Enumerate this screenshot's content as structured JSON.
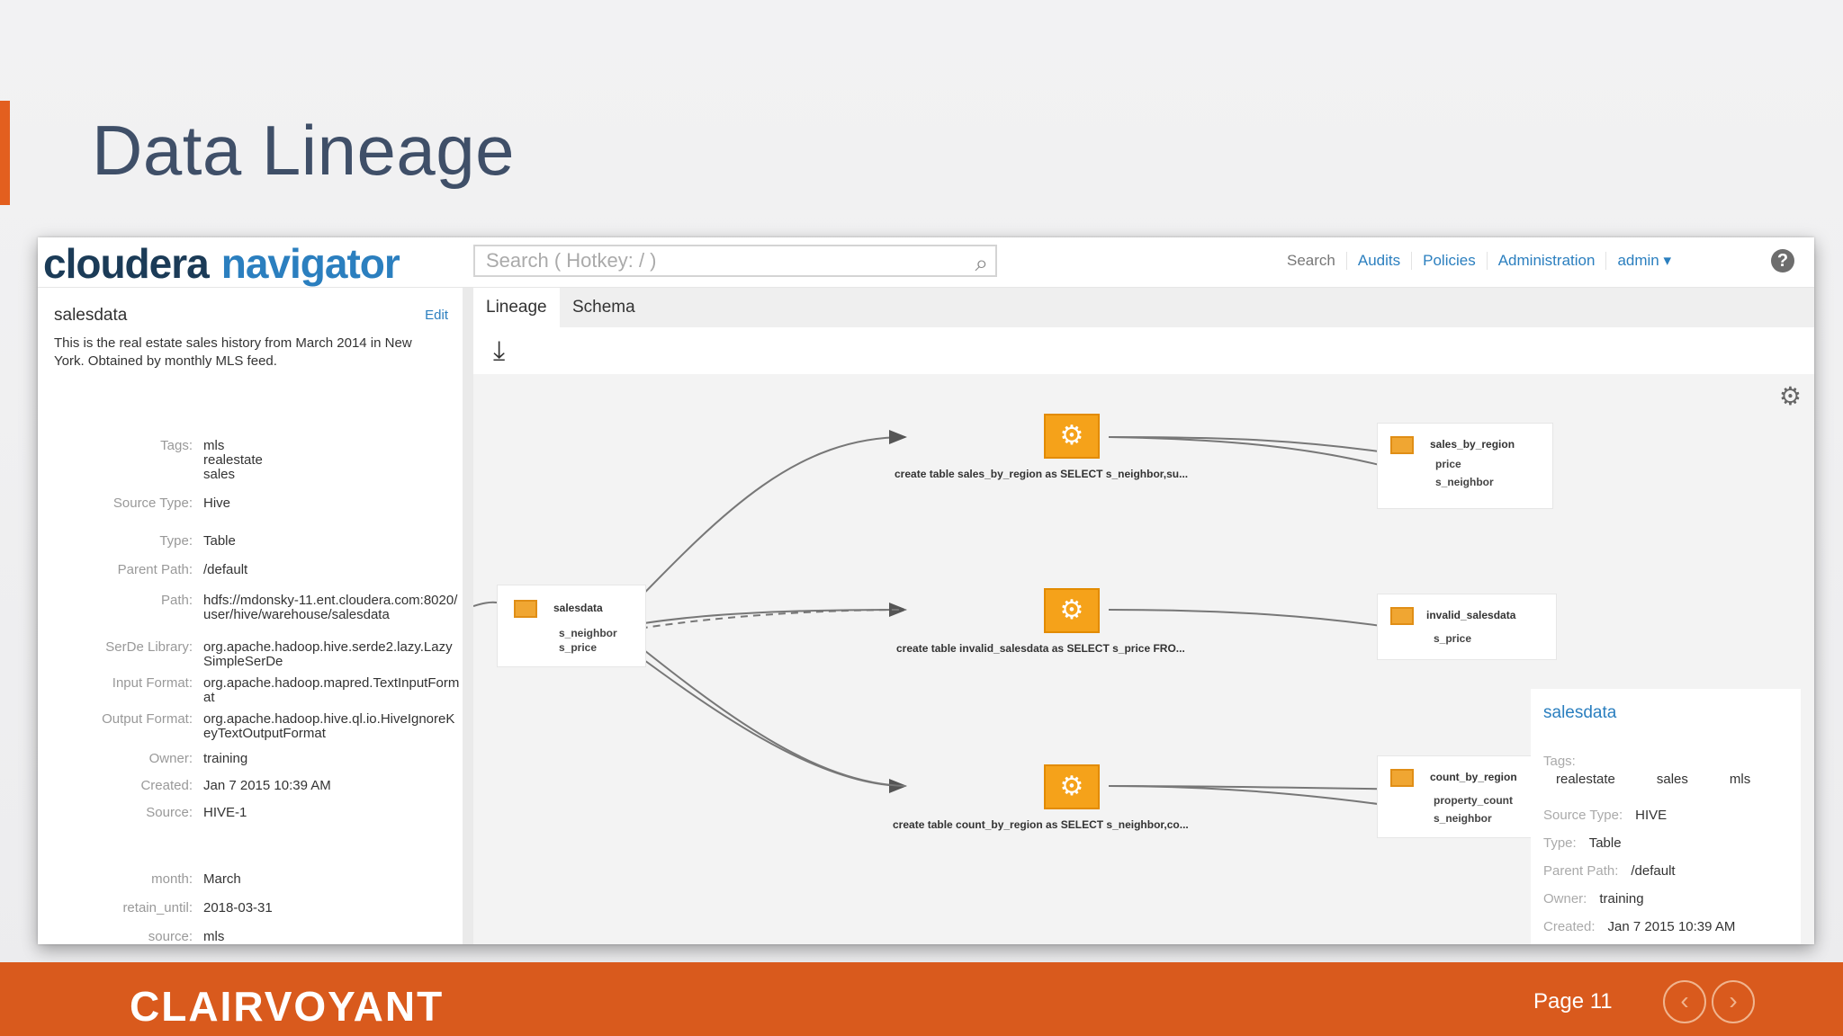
{
  "slide": {
    "title": "Data Lineage",
    "brand": "CLAIRVOYANT",
    "page_label": "Page 11",
    "prev_glyph": "‹",
    "next_glyph": "›"
  },
  "app": {
    "logo_part1": "cloudera",
    "logo_part2": "navigator",
    "search_placeholder": "Search ( Hotkey: / )",
    "nav": [
      "Search",
      "Audits",
      "Policies",
      "Administration",
      "admin ▾"
    ],
    "help_glyph": "?"
  },
  "entity": {
    "name": "salesdata",
    "edit_label": "Edit",
    "description": "This is the real estate sales history from March 2014 in New York. Obtained by monthly MLS feed.",
    "properties": [
      {
        "key": "Tags:",
        "value": "mls\nrealestate\nsales"
      },
      {
        "key": "Source Type:",
        "value": "Hive"
      },
      {
        "key": "Type:",
        "value": "Table"
      },
      {
        "key": "Parent Path:",
        "value": "/default"
      },
      {
        "key": "Path:",
        "value": "hdfs://mdonsky-11.ent.cloudera.com:8020/user/hive/warehouse/salesdata"
      },
      {
        "key": "SerDe Library:",
        "value": "org.apache.hadoop.hive.serde2.lazy.LazySimpleSerDe"
      },
      {
        "key": "Input Format:",
        "value": "org.apache.hadoop.mapred.TextInputFormat"
      },
      {
        "key": "Output Format:",
        "value": "org.apache.hadoop.hive.ql.io.HiveIgnoreKeyTextOutputFormat"
      },
      {
        "key": "Owner:",
        "value": "training"
      },
      {
        "key": "Created:",
        "value": "Jan 7 2015 10:39 AM"
      },
      {
        "key": "Source:",
        "value": "HIVE-1"
      },
      {
        "key": "month:",
        "value": "March"
      },
      {
        "key": "retain_until:",
        "value": "2018-03-31"
      },
      {
        "key": "source:",
        "value": "mls"
      }
    ]
  },
  "tabs": [
    "Lineage",
    "Schema"
  ],
  "lineage": {
    "source": {
      "name": "salesdata",
      "cols": [
        "s_neighbor",
        "s_price"
      ]
    },
    "operations": [
      "create table sales_by_region as SELECT s_neighbor,su...",
      "create table invalid_salesdata as SELECT s_price FRO...",
      "create table count_by_region as SELECT s_neighbor,co..."
    ],
    "targets": [
      {
        "name": "sales_by_region",
        "cols": [
          "price",
          "s_neighbor"
        ]
      },
      {
        "name": "invalid_salesdata",
        "cols": [
          "s_price"
        ]
      },
      {
        "name": "count_by_region",
        "cols": [
          "property_count",
          "s_neighbor"
        ]
      }
    ]
  },
  "infobox": {
    "title": "salesdata",
    "tags_label": "Tags:",
    "tags": [
      "realestate",
      "sales",
      "mls"
    ],
    "rows": [
      {
        "key": "Source Type:",
        "value": "HIVE"
      },
      {
        "key": "Type:",
        "value": "Table"
      },
      {
        "key": "Parent Path:",
        "value": "/default"
      },
      {
        "key": "Owner:",
        "value": "training"
      },
      {
        "key": "Created:",
        "value": "Jan 7 2015 10:39 AM"
      }
    ]
  },
  "colors": {
    "accent": "#d95a1d",
    "link": "#2b7fbf",
    "operation": "#f5a21a"
  },
  "icons": [
    "search-icon",
    "help-icon",
    "download-icon",
    "gear-icon",
    "table-icon",
    "operation-gears-icon",
    "chevron-left-icon",
    "chevron-right-icon"
  ]
}
